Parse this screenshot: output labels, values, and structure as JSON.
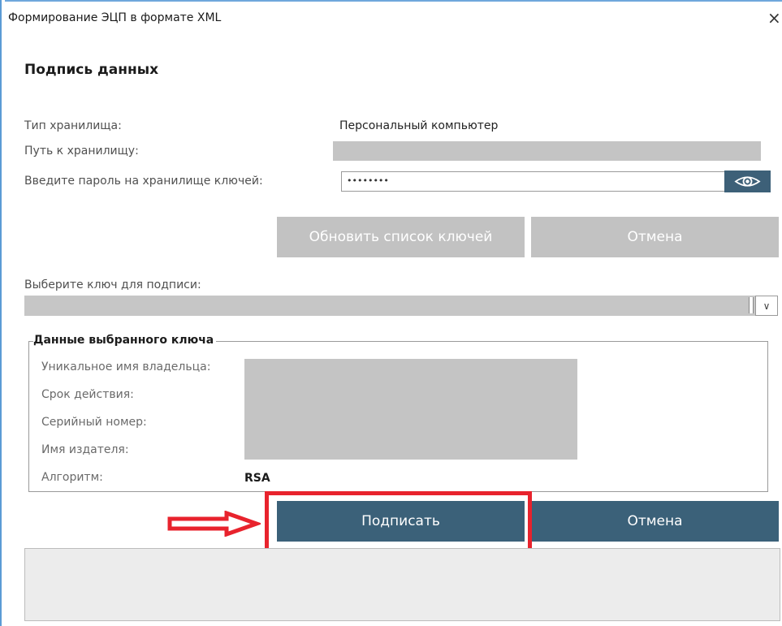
{
  "window": {
    "title": "Формирование ЭЦП в формате XML",
    "close_glyph": "×"
  },
  "heading": "Подпись данных",
  "storage": {
    "type_label": "Тип хранилища:",
    "type_value": "Персональный компьютер",
    "path_label": "Путь к хранилищу:",
    "password_label": "Введите пароль на хранилище ключей:",
    "password_value": "••••••••",
    "show_password_icon": "eye-icon"
  },
  "buttons_top": {
    "refresh_label": "Обновить список ключей",
    "cancel_label": "Отмена"
  },
  "key_select": {
    "label": "Выберите ключ для подписи:",
    "arrow_glyph": "∨"
  },
  "key_details": {
    "group_title": "Данные выбранного ключа",
    "owner_label": "Уникальное имя владельца:",
    "validity_label": "Срок действия:",
    "serial_label": "Серийный номер:",
    "issuer_label": "Имя издателя:",
    "algorithm_label": "Алгоритм:",
    "algorithm_value": "RSA"
  },
  "buttons_bottom": {
    "sign_label": "Подписать",
    "cancel_label": "Отмена"
  },
  "colors": {
    "accent_dark": "#3b6179",
    "disabled_gray": "#c2c2c2",
    "highlight_red": "#e8232d"
  }
}
